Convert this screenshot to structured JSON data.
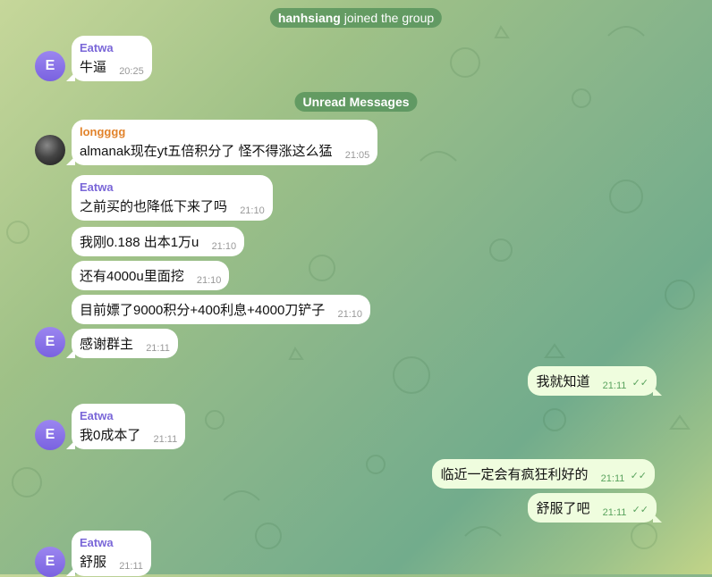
{
  "service": {
    "join_user": "hanhsiang",
    "join_text": "joined the group",
    "unread_label": "Unread Messages"
  },
  "avatars": {
    "eatwa_initial": "E"
  },
  "messages": [
    {
      "sender": "Eatwa",
      "text": "牛逼",
      "time": "20:25"
    },
    {
      "sender": "longggg",
      "text": "almanak现在yt五倍积分了 怪不得涨这么猛",
      "time": "21:05"
    },
    {
      "sender": "Eatwa",
      "text": "之前买的也降低下来了吗",
      "time": "21:10"
    },
    {
      "sender": "",
      "text": "我刚0.188 出本1万u",
      "time": "21:10"
    },
    {
      "sender": "",
      "text": "还有4000u里面挖",
      "time": "21:10"
    },
    {
      "sender": "",
      "text": "目前嫖了9000积分+400利息+4000刀铲子",
      "time": "21:10"
    },
    {
      "sender": "",
      "text": "感谢群主",
      "time": "21:11"
    },
    {
      "sender": "",
      "text": "我就知道",
      "time": "21:11"
    },
    {
      "sender": "Eatwa",
      "text": "我0成本了",
      "time": "21:11"
    },
    {
      "sender": "",
      "text": "临近一定会有疯狂利好的",
      "time": "21:11"
    },
    {
      "sender": "",
      "text": "舒服了吧",
      "time": "21:11"
    },
    {
      "sender": "Eatwa",
      "text": "舒服",
      "time": "21:11"
    }
  ],
  "colors": {
    "incoming_bg": "#ffffff",
    "outgoing_bg": "#effdde",
    "service_bg": "#4c8c54",
    "name_purple": "#7a67d8",
    "name_orange": "#e2832b",
    "read_check": "#5aa35e"
  },
  "icons": {
    "read_receipt": "double-check-icon"
  }
}
